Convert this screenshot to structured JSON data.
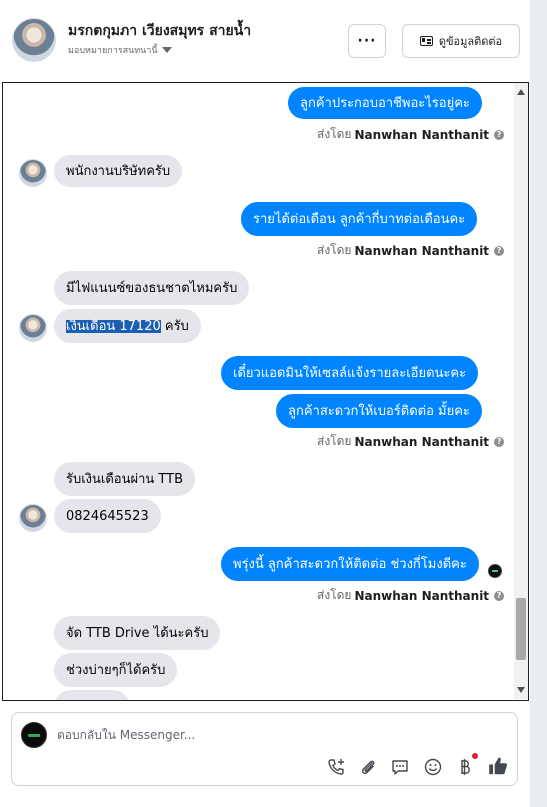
{
  "header": {
    "name": "มรกตกุมภา เวียงสมุทร สายน้ำ",
    "assign_label": "มอบหมายการสนทนานี้",
    "more_label": "···",
    "contact_label": "ดูข้อมูลติดต่อ"
  },
  "conversation": {
    "sent_by_prefix": "ส่งโดย",
    "agent_name": "Nanwhan Nanthanit",
    "info_symbol": "?",
    "messages": [
      {
        "dir": "out",
        "text": "ลูกค้าประกอบอาชีพอะไรอยู่คะ"
      },
      {
        "dir": "in",
        "text": "พนักงานบริษัทครับ"
      },
      {
        "dir": "out",
        "text": "รายได้ต่อเดือน ลูกค้ากี่บาทต่อเดือนคะ"
      },
      {
        "dir": "in",
        "text": "มีไฟแนนซ์ของธนชาตไหมครับ"
      },
      {
        "dir": "in",
        "text_highlight": "เงินเดือน 17120",
        "text_rest": " ครับ"
      },
      {
        "dir": "out",
        "text": "เดี๋ยวแอดมินให้เซลล์แจ้งรายละเอียดนะคะ"
      },
      {
        "dir": "out",
        "text": "ลูกค้าสะดวกให้เบอร์ติดต่อ มั้ยคะ"
      },
      {
        "dir": "in",
        "text": "รับเงินเดือนผ่าน TTB"
      },
      {
        "dir": "in",
        "text": "0824645523"
      },
      {
        "dir": "out",
        "text": "พรุ่งนี้ ลูกค้าสะดวกให้ติดต่อ ช่วงกี่โมงดีคะ"
      },
      {
        "dir": "in",
        "text": "จัด TTB Drive ได้นะครับ"
      },
      {
        "dir": "in",
        "text": "ช่วงบ่ายๆก็ได้ครับ"
      }
    ]
  },
  "composer": {
    "placeholder": "ตอบกลับใน Messenger...",
    "tools": [
      "call-add-icon",
      "attachment-icon",
      "saved-reply-icon",
      "emoji-icon",
      "baht-payment-icon",
      "thumbs-up-icon"
    ]
  },
  "colors": {
    "outgoing_bubble": "#0084ff",
    "incoming_bubble": "#e4e6eb",
    "highlight": "#1a5fb4",
    "notification_dot": "#e41e3f"
  }
}
